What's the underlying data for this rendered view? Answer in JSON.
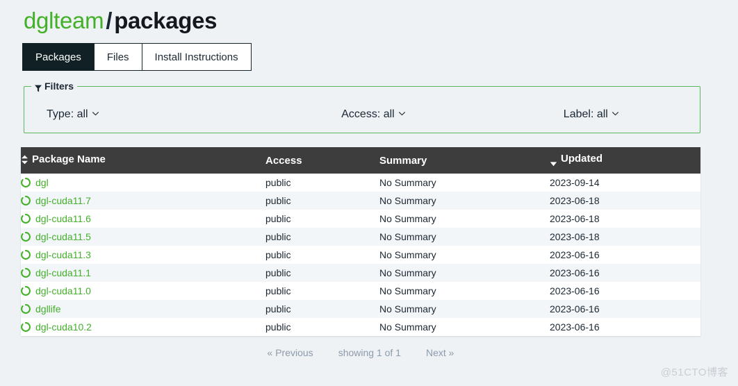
{
  "header": {
    "owner": "dglteam",
    "separator": "/",
    "repo": "packages"
  },
  "tabs": [
    {
      "label": "Packages",
      "active": true
    },
    {
      "label": "Files",
      "active": false
    },
    {
      "label": "Install Instructions",
      "active": false
    }
  ],
  "filters": {
    "legend": "Filters",
    "icon": "funnel-icon",
    "items": [
      {
        "label": "Type: all",
        "name": "type"
      },
      {
        "label": "Access: all",
        "name": "access"
      },
      {
        "label": "Label: all",
        "name": "label"
      }
    ]
  },
  "table": {
    "columns": [
      {
        "label": "Package Name",
        "sort": "updown",
        "key": "name"
      },
      {
        "label": "Access",
        "sort": "none",
        "key": "access"
      },
      {
        "label": "Summary",
        "sort": "none",
        "key": "summary"
      },
      {
        "label": "Updated",
        "sort": "desc",
        "key": "updated"
      }
    ],
    "rows": [
      {
        "icon": "conda-package-icon",
        "name": "dgl",
        "access": "public",
        "summary": "No Summary",
        "updated": "2023-09-14"
      },
      {
        "icon": "conda-package-icon",
        "name": "dgl-cuda11.7",
        "access": "public",
        "summary": "No Summary",
        "updated": "2023-06-18"
      },
      {
        "icon": "conda-package-icon",
        "name": "dgl-cuda11.6",
        "access": "public",
        "summary": "No Summary",
        "updated": "2023-06-18"
      },
      {
        "icon": "conda-package-icon",
        "name": "dgl-cuda11.5",
        "access": "public",
        "summary": "No Summary",
        "updated": "2023-06-18"
      },
      {
        "icon": "conda-package-icon",
        "name": "dgl-cuda11.3",
        "access": "public",
        "summary": "No Summary",
        "updated": "2023-06-16"
      },
      {
        "icon": "conda-package-icon",
        "name": "dgl-cuda11.1",
        "access": "public",
        "summary": "No Summary",
        "updated": "2023-06-16"
      },
      {
        "icon": "conda-package-icon",
        "name": "dgl-cuda11.0",
        "access": "public",
        "summary": "No Summary",
        "updated": "2023-06-16"
      },
      {
        "icon": "conda-package-icon",
        "name": "dgllife",
        "access": "public",
        "summary": "No Summary",
        "updated": "2023-06-16"
      },
      {
        "icon": "conda-package-icon",
        "name": "dgl-cuda10.2",
        "access": "public",
        "summary": "No Summary",
        "updated": "2023-06-16"
      }
    ]
  },
  "pagination": {
    "previous": "« Previous",
    "status": "showing 1 of 1",
    "next": "Next »"
  },
  "watermark": "@51CTO博客",
  "colors": {
    "brand_green": "#43b02a",
    "filter_border": "#5cb85c",
    "tab_active_bg": "#112024",
    "table_head_bg": "#3d3d3d",
    "page_bg": "#eef2f5",
    "row_alt_bg": "#f2f6f8",
    "muted_text": "#8c9bab"
  }
}
